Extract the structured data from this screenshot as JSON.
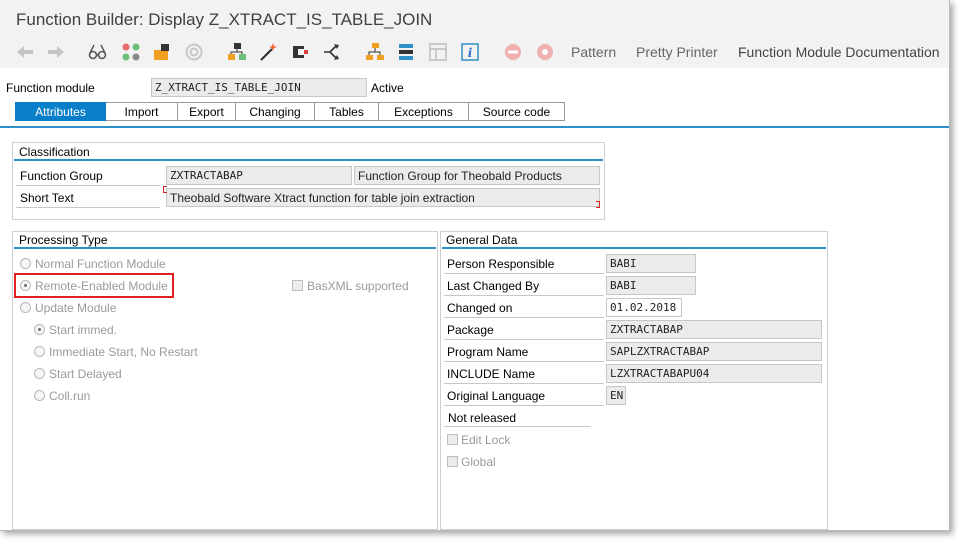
{
  "window": {
    "title": "Function Builder: Display Z_XTRACT_IS_TABLE_JOIN"
  },
  "toolbar": {
    "icons": [
      "back-arrow-icon",
      "forward-arrow-icon",
      "glasses-icon",
      "molecule-icon",
      "object-icon",
      "circle-icon",
      "hierarchy-icon",
      "magic-wand-icon",
      "clamp-icon",
      "split-arrows-icon",
      "tree-icon",
      "stack-icon",
      "layout-icon",
      "info-icon",
      "stop-icon",
      "gear-icon"
    ],
    "pattern": "Pattern",
    "pretty_printer": "Pretty Printer",
    "documentation": "Function Module Documentation"
  },
  "header": {
    "function_module_label": "Function module",
    "function_module_value": "Z_XTRACT_IS_TABLE_JOIN",
    "status": "Active"
  },
  "tabs": [
    "Attributes",
    "Import",
    "Export",
    "Changing",
    "Tables",
    "Exceptions",
    "Source code"
  ],
  "classification": {
    "title": "Classification",
    "function_group_label": "Function Group",
    "function_group_value": "ZXTRACTABAP",
    "function_group_desc": "Function Group for Theobald Products",
    "short_text_label": "Short Text",
    "short_text_value": "Theobald Software Xtract function for table join extraction"
  },
  "processing": {
    "title": "Processing Type",
    "normal": "Normal Function Module",
    "remote": "Remote-Enabled Module",
    "basxml": "BasXML supported",
    "update": "Update Module",
    "start_immed": "Start immed.",
    "immediate_no_restart": "Immediate Start, No Restart",
    "start_delayed": "Start Delayed",
    "coll_run": "Coll.run"
  },
  "general": {
    "title": "General Data",
    "person_label": "Person Responsible",
    "person_value": "BABI",
    "last_changed_label": "Last Changed By",
    "last_changed_value": "BABI",
    "changed_on_label": "Changed on",
    "changed_on_value": "01.02.2018",
    "package_label": "Package",
    "package_value": "ZXTRACTABAP",
    "program_label": "Program Name",
    "program_value": "SAPLZXTRACTABAP",
    "include_label": "INCLUDE Name",
    "include_value": "LZXTRACTABAPU04",
    "lang_label": "Original Language",
    "lang_value": "EN",
    "not_released": "Not released",
    "edit_lock": "Edit Lock",
    "global": "Global"
  },
  "colors": {
    "accent": "#0a7fc9",
    "highlight": "#e0211f"
  }
}
